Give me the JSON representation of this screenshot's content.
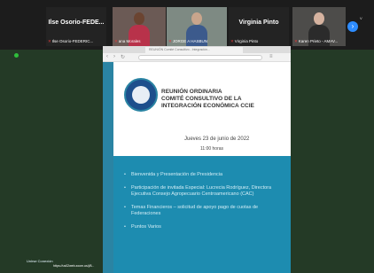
{
  "participants": [
    {
      "name_big": "Ilse Osorio-FEDE...",
      "caption": "Ilse Osorio-FEDERIC..."
    },
    {
      "name_big": "",
      "caption": "ana Morales"
    },
    {
      "name_big": "",
      "caption": "JORGE A HASBUN"
    },
    {
      "name_big": "Virginia Pinto",
      "caption": "Virginia Pinto"
    },
    {
      "name_big": "",
      "caption": "Karen Prieto - AMAV..."
    }
  ],
  "side_label": "V",
  "browser": {
    "tab_title": "REUNIÓN Comité Consultivo - Integración..."
  },
  "slide": {
    "title_line1": "REUNIÓN ORDINARIA",
    "title_line2": "COMITÉ CONSULTIVO DE LA",
    "title_line3": "INTEGRACIÓN ECONÓMICA CCIE",
    "date": "Jueves 23 de junio de 2022",
    "time": "11:00 horas",
    "bullets": [
      "Bienvenida y Presentación de Presidencia",
      "Participación de invitada Especial: Lucrecia Rodríguez, Directora Ejecutiva Consejo Agropecuario Centroamericano (CAC)",
      "Temas Financieros – solicitud de apoyo pago de cuotas de Federaciones",
      "Puntos Varios"
    ],
    "footer_small": "Unirse Conexión",
    "footer_link": "https://us02web.zoom.us/j/8..."
  }
}
